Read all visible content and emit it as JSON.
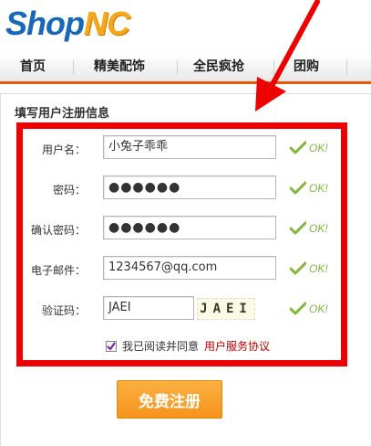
{
  "logo": {
    "part1": "Shop",
    "part2": "NC"
  },
  "nav": {
    "items": [
      {
        "label": "首页"
      },
      {
        "label": "精美配饰"
      },
      {
        "label": "全民疯抢"
      },
      {
        "label": "团购"
      }
    ]
  },
  "form": {
    "title": "填写用户注册信息",
    "username": {
      "label": "用户名：",
      "value": "小兔子乖乖"
    },
    "password": {
      "label": "密码：",
      "value": "●●●●●●"
    },
    "confirm_password": {
      "label": "确认密码：",
      "value": "●●●●●●"
    },
    "email": {
      "label": "电子邮件：",
      "value": "1234567@qq.com"
    },
    "captcha": {
      "label": "验证码：",
      "value": "JAEI",
      "image_text": "JAEI"
    },
    "ok_text": "OK!",
    "agree_text": "我已阅读并同意",
    "agree_link": "用户服务协议",
    "agree_checked": true,
    "submit_label": "免费注册"
  },
  "colors": {
    "highlight_border": "#ee0000",
    "arrow": "#ee0000",
    "nav_accent": "#e15c0f",
    "ok_green": "#82b73a",
    "submit_orange": "#f6941d",
    "link_red": "#c00000"
  }
}
